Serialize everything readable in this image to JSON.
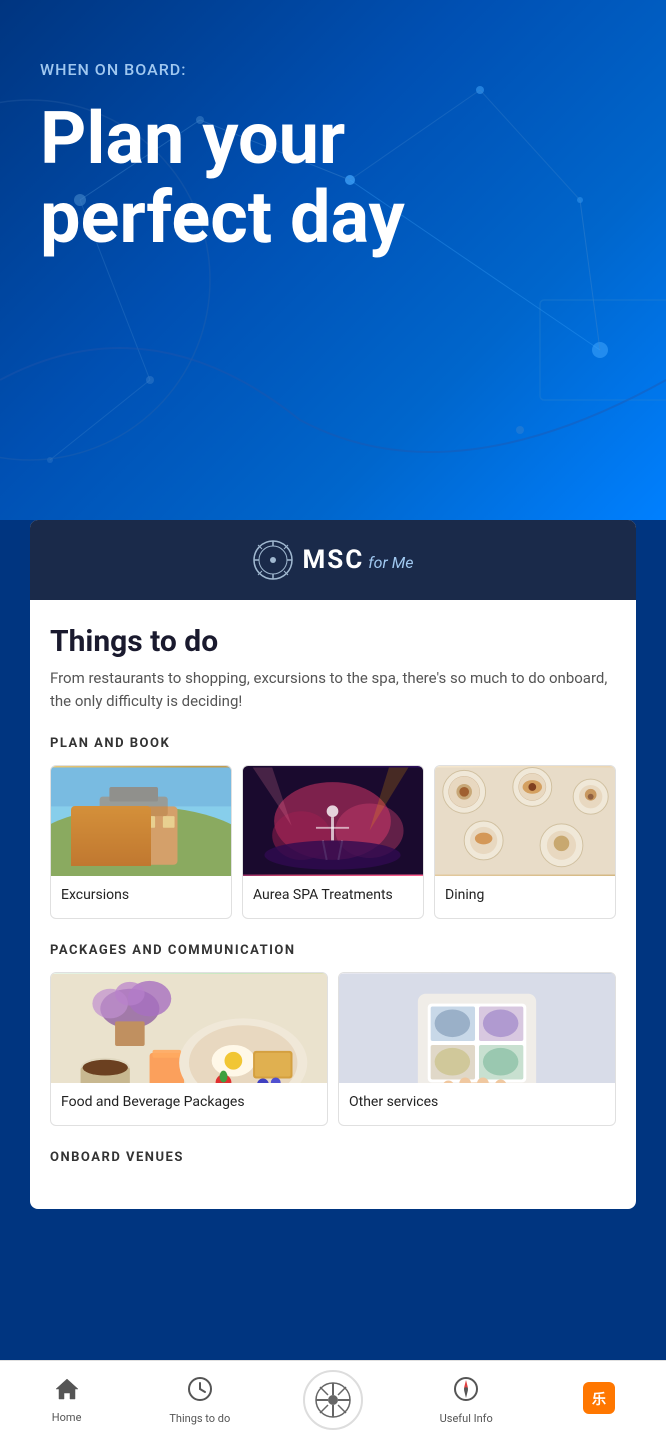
{
  "hero": {
    "subtitle": "WHEN ON BOARD:",
    "title_line1": "Plan your",
    "title_line2": "perfect day"
  },
  "msc": {
    "logo_text": "MSC",
    "logo_sub": "for Me"
  },
  "things_to_do": {
    "title": "Things to do",
    "description": "From restaurants to shopping, excursions to the spa, there's so much to do onboard, the only difficulty is deciding!"
  },
  "plan_and_book": {
    "label": "PLAN AND BOOK",
    "items": [
      {
        "id": "excursions",
        "label": "Excursions"
      },
      {
        "id": "spa",
        "label": "Aurea SPA Treatments"
      },
      {
        "id": "dining",
        "label": "Dining"
      }
    ]
  },
  "packages": {
    "label": "PACKAGES AND COMMUNICATION",
    "items": [
      {
        "id": "food-bev",
        "label": "Food and Beverage Packages"
      },
      {
        "id": "other",
        "label": "Other services"
      }
    ]
  },
  "onboard_venues": {
    "label": "ONBOARD VENUES"
  },
  "nav": {
    "items": [
      {
        "id": "home",
        "icon": "⌂",
        "label": "Home"
      },
      {
        "id": "things",
        "icon": "⏱",
        "label": "Things to do"
      },
      {
        "id": "center",
        "icon": "⚙",
        "label": ""
      },
      {
        "id": "useful",
        "icon": "◎",
        "label": "Useful Info"
      },
      {
        "id": "le-you",
        "icon": "🎮",
        "label": ""
      }
    ]
  }
}
